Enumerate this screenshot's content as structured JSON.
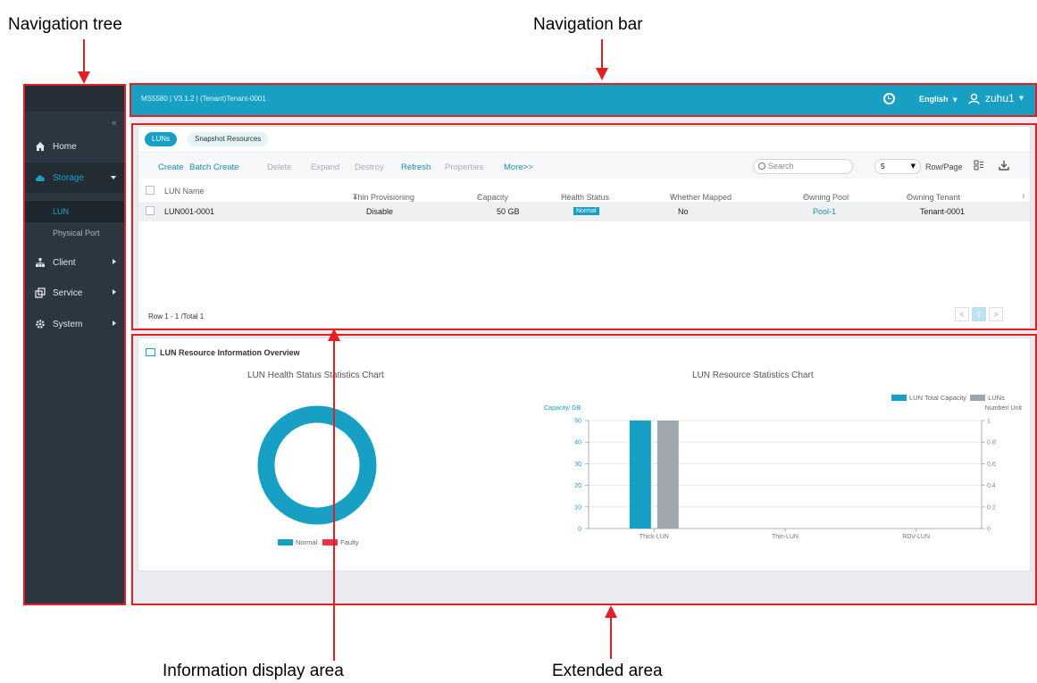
{
  "callouts": {
    "nav_tree": "Navigation tree",
    "nav_bar": "Navigation bar",
    "info_area": "Information display area",
    "ext_area": "Extended area"
  },
  "sidebar": {
    "collapse": "«",
    "items": [
      {
        "label": "Home",
        "icon": "home-icon"
      },
      {
        "label": "Storage",
        "icon": "cloud-icon",
        "active": true
      },
      {
        "label": "Client",
        "icon": "client-icon"
      },
      {
        "label": "Service",
        "icon": "service-icon"
      },
      {
        "label": "System",
        "icon": "gear-icon"
      }
    ],
    "sub_items": [
      "LUN",
      "Physical Port"
    ]
  },
  "topbar": {
    "title": "MS5580 | V3.1.2 | (Tenant)Tenant-0001",
    "language": "English",
    "user": "zuhu1"
  },
  "tabs": [
    "LUNs",
    "Snapshot Resources"
  ],
  "toolbar": {
    "buttons": [
      "Create",
      "Batch Create",
      "Delete",
      "Expand",
      "Destroy",
      "Refresh",
      "Properties",
      "More>>"
    ],
    "search_placeholder": "Search",
    "page_size": "5",
    "row_page_label": "Row/Page"
  },
  "table": {
    "headers": [
      "LUN Name",
      "Thin Provisioning",
      "Capacity",
      "Health Status",
      "Whether Mapped",
      "Owning Pool",
      "Owning Tenant"
    ],
    "rows": [
      [
        "LUN001-0001",
        "Disable",
        "50 GB",
        "Normal",
        "No",
        "Pool-1",
        "Tenant-0001"
      ]
    ],
    "footer": "Row 1 - 1 /Total 1",
    "pager": {
      "prev": "<",
      "current": "1",
      "next": ">"
    }
  },
  "overview": {
    "title": "LUN Resource Information Overview"
  },
  "colors": {
    "accent": "#17a0c4",
    "gray_bar": "#9ea7ab",
    "faulty": "#e8334a",
    "sidebar_bg": "#2b3640",
    "callout_red": "#e31e24"
  },
  "chart_data": [
    {
      "type": "pie",
      "title": "LUN Health Status Statistics Chart",
      "categories": [
        "Normal",
        "Faulty"
      ],
      "values": [
        1,
        0
      ],
      "legend_position": "bottom"
    },
    {
      "type": "bar",
      "title": "LUN Resource Statistics Chart",
      "categories": [
        "Thick-LUN",
        "Thin-LUN",
        "RDV-LUN"
      ],
      "series": [
        {
          "name": "LUN Total Capacity",
          "values": [
            50,
            0,
            0
          ]
        },
        {
          "name": "LUNs",
          "values": [
            1,
            0,
            0
          ]
        }
      ],
      "ylabel_left": "Capacity/ GB",
      "ylabel_right": "Number/ Unit",
      "ylim_left": [
        0,
        50
      ],
      "ylim_right": [
        0,
        1
      ],
      "yticks_left": [
        "0",
        "10",
        "20",
        "30",
        "40",
        "50"
      ],
      "yticks_right": [
        "0",
        "0.2",
        "0.4",
        "0.6",
        "0.8",
        "1"
      ],
      "legend_position": "top-right",
      "grid": true
    }
  ]
}
